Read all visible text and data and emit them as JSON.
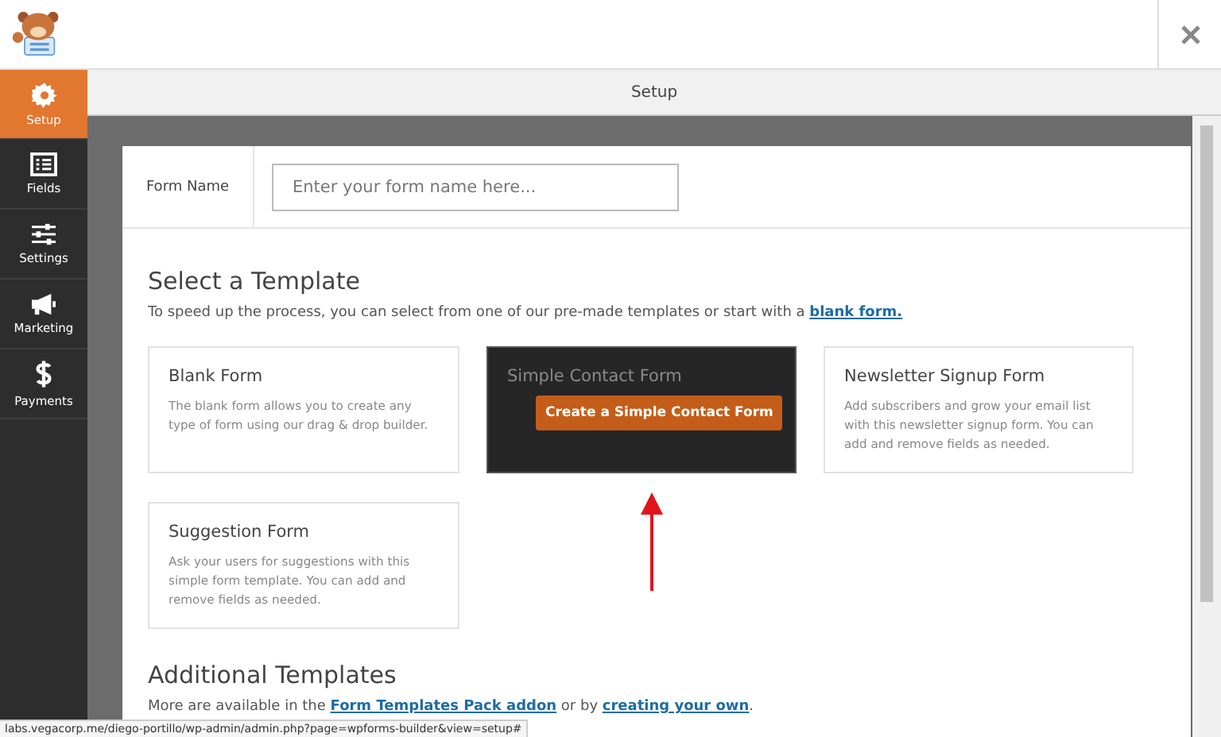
{
  "header": {
    "title": "Setup"
  },
  "sidebar": {
    "items": [
      {
        "label": "Setup",
        "selected": true
      },
      {
        "label": "Fields",
        "selected": false
      },
      {
        "label": "Settings",
        "selected": false
      },
      {
        "label": "Marketing",
        "selected": false
      },
      {
        "label": "Payments",
        "selected": false
      }
    ]
  },
  "form_name": {
    "label": "Form Name",
    "placeholder": "Enter your form name here..."
  },
  "select_template": {
    "title": "Select a Template",
    "intro": "To speed up the process, you can select from one of our pre-made templates or start with a ",
    "intro_link": "blank form."
  },
  "templates": [
    {
      "title": "Blank Form",
      "description": "The blank form allows you to create any type of form using our drag & drop builder.",
      "hovered": false
    },
    {
      "title": "Simple Contact Form",
      "hovered": true,
      "button": "Create a Simple Contact Form"
    },
    {
      "title": "Newsletter Signup Form",
      "description": "Add subscribers and grow your email list with this newsletter signup form. You can add and remove fields as needed.",
      "hovered": false
    },
    {
      "title": "Suggestion Form",
      "description": "Ask your users for suggestions with this simple form template. You can add and remove fields as needed.",
      "hovered": false
    }
  ],
  "additional": {
    "title": "Additional Templates",
    "text_before": "More are available in the ",
    "link1": "Form Templates Pack addon",
    "text_middle": " or by ",
    "link2": "creating your own",
    "text_after": "."
  },
  "status_bar": {
    "url": "labs.vegacorp.me/diego-portillo/wp-admin/admin.php?page=wpforms-builder&view=setup#"
  }
}
